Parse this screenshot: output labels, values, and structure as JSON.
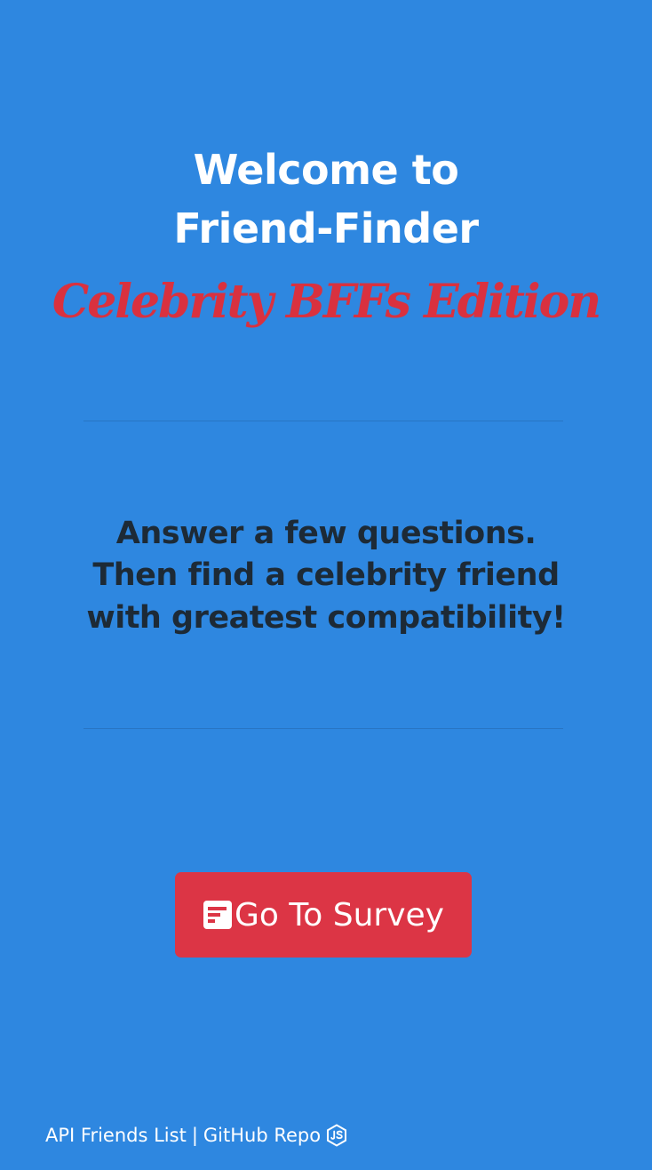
{
  "header": {
    "title_line1": "Welcome to",
    "title_line2": "Friend-Finder",
    "subtitle": "Celebrity BFFs Edition"
  },
  "intro": {
    "line1": "Answer a few questions.",
    "line2": "Then find a celebrity friend",
    "line3": "with greatest compatibility!"
  },
  "survey_button": {
    "icon": "survey-form-icon",
    "label": "Go To Survey"
  },
  "footer": {
    "api_link": "API Friends List",
    "separator": "|",
    "github_link": "GitHub Repo",
    "github_icon": "nodejs-icon"
  },
  "colors": {
    "background": "#2e87e0",
    "title": "#ffffff",
    "subtitle": "#d9313f",
    "intro_text": "#1d2a36",
    "button": "#dc3545"
  }
}
